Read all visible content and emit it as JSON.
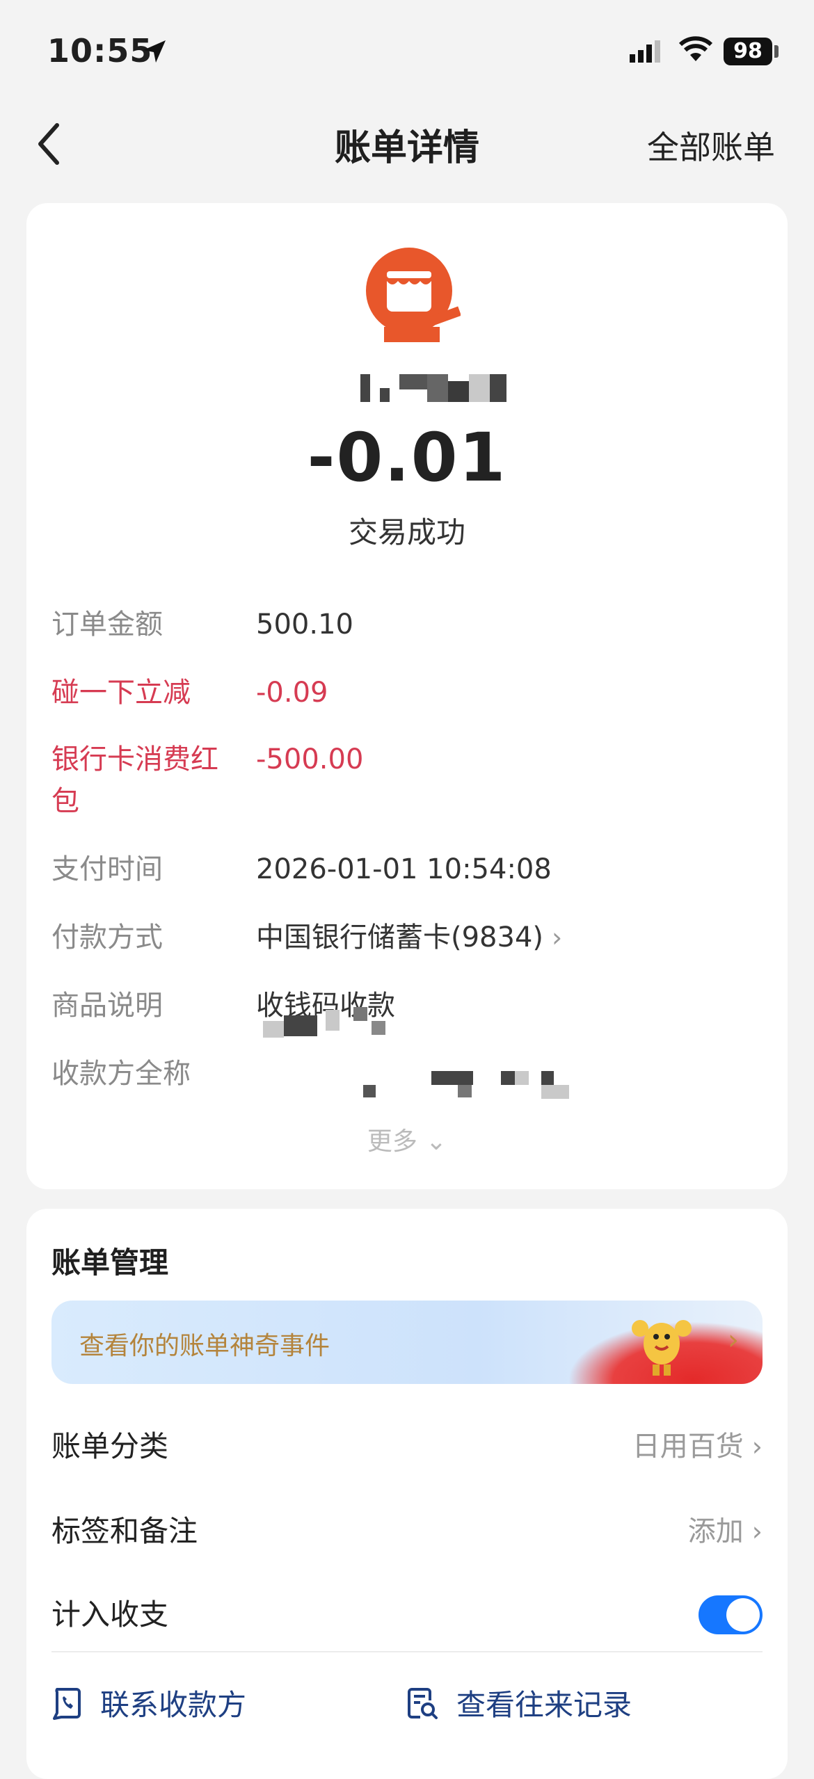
{
  "status_bar": {
    "time": "10:55",
    "battery": "98"
  },
  "nav": {
    "title": "账单详情",
    "right_label": "全部账单"
  },
  "detail": {
    "amount": "-0.01",
    "status": "交易成功",
    "rows": [
      {
        "label": "订单金额",
        "value": "500.10"
      },
      {
        "label": "碰一下立减",
        "value": "-0.09"
      },
      {
        "label": "银行卡消费红包",
        "value": "-500.00"
      },
      {
        "label": "支付时间",
        "value": "2026-01-01 10:54:08"
      },
      {
        "label": "付款方式",
        "value": "中国银行储蓄卡(9834)"
      },
      {
        "label": "商品说明",
        "value": "收钱码收款"
      },
      {
        "label": "收款方全称",
        "value": ""
      }
    ],
    "more_label": "更多"
  },
  "management": {
    "title": "账单管理",
    "banner_text": "查看你的账单神奇事件",
    "category_label": "账单分类",
    "category_value": "日用百货",
    "tags_label": "标签和备注",
    "tags_value": "添加",
    "include_label": "计入收支",
    "include_enabled": true,
    "contact_label": "联系收款方",
    "history_label": "查看往来记录"
  },
  "colors": {
    "accent": "#1677ff",
    "discount_red": "#d63b52",
    "merchant_orange": "#e8572b",
    "link_blue": "#1e3f82"
  }
}
